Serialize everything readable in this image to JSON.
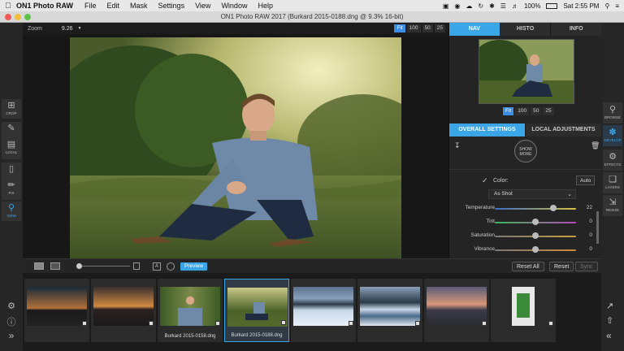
{
  "menubar": {
    "app_name": "ON1 Photo RAW",
    "items": [
      "File",
      "Edit",
      "Mask",
      "Settings",
      "View",
      "Window",
      "Help"
    ],
    "battery": "100%",
    "time": "Sat 2:55 PM"
  },
  "window": {
    "title": "ON1 Photo RAW 2017 (Burkard 2015-0188.dng @ 9.3% 16-bit)"
  },
  "left_tools": [
    {
      "label": "CROP",
      "icon": "crop-icon"
    },
    {
      "label": "",
      "icon": "brush-icon"
    },
    {
      "label": "LOCAL",
      "icon": "local-adjust-icon"
    },
    {
      "label": "",
      "icon": "bandage-icon"
    },
    {
      "label": "FIX",
      "icon": "stamp-icon"
    },
    {
      "label": "VIEW",
      "icon": "magnifier-icon"
    }
  ],
  "zoom": {
    "label": "Zoom",
    "value": "9.26",
    "buttons": [
      "Fit",
      "100",
      "50",
      "25"
    ],
    "active": "Fit"
  },
  "panel": {
    "tabs": [
      "NAV",
      "HISTO",
      "INFO"
    ],
    "active_tab": "NAV",
    "nav_buttons": [
      "Fit",
      "100",
      "50",
      "25"
    ],
    "settings_tabs": [
      "OVERALL SETTINGS",
      "LOCAL ADJUSTMENTS"
    ],
    "show_more": "SHOW MORE",
    "color_label": "Color:",
    "auto_label": "Auto",
    "white_balance": "As Shot",
    "sliders": [
      {
        "label": "Temperature",
        "value": "22",
        "position": 0.72,
        "color": "#3a6cc8"
      },
      {
        "label": "Tint",
        "value": "0",
        "position": 0.5,
        "color": "#8e4ab8"
      },
      {
        "label": "Saturation",
        "value": "0",
        "position": 0.5,
        "color": "#888888"
      },
      {
        "label": "Vibrance",
        "value": "0",
        "position": 0.5,
        "color": "#c07a3a"
      }
    ]
  },
  "bottom": {
    "preview_label": "Preview",
    "reset_all": "Reset All",
    "reset": "Reset",
    "sync": "Sync",
    "a_label": "A"
  },
  "filmstrip": [
    {
      "caption": "",
      "scene": "sunset-dark"
    },
    {
      "caption": "",
      "scene": "sunset-warm"
    },
    {
      "caption": "Burkard 2015-0158.dng",
      "scene": "portrait-close"
    },
    {
      "caption": "Burkard 2015-0188.dng",
      "scene": "portrait-field",
      "selected": true
    },
    {
      "caption": "",
      "scene": "mountain"
    },
    {
      "caption": "",
      "scene": "mountain-lake"
    },
    {
      "caption": "",
      "scene": "dusk-road"
    },
    {
      "caption": "",
      "scene": "document"
    }
  ],
  "right_tools": [
    {
      "label": "BROWSE",
      "icon": "browse-icon"
    },
    {
      "label": "DEVELOP",
      "icon": "develop-icon",
      "active": true
    },
    {
      "label": "EFFECTS",
      "icon": "effects-icon"
    },
    {
      "label": "LAYERS",
      "icon": "layers-icon"
    },
    {
      "label": "RESIZE",
      "icon": "resize-icon"
    }
  ],
  "colors": {
    "accent": "#3aa6e8"
  }
}
